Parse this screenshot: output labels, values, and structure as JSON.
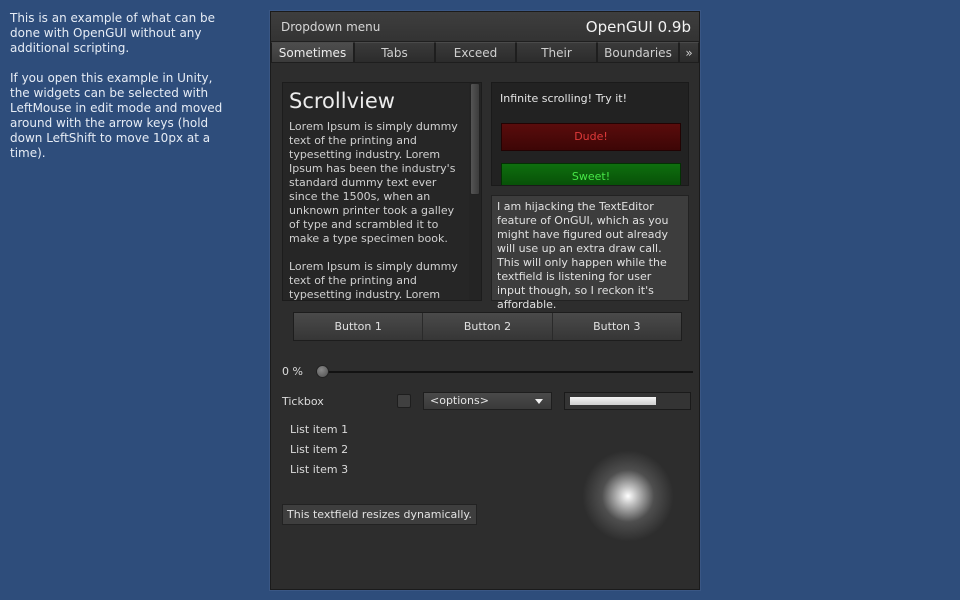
{
  "intro": {
    "paragraph1": "This is an example of what can be done with OpenGUI without any additional scripting.",
    "paragraph2": "If you open this example in Unity, the widgets can be selected with LeftMouse in edit mode and moved around with the arrow keys (hold down LeftShift to move 10px at a time)."
  },
  "window": {
    "title_left": "Dropdown menu",
    "title_right": "OpenGUI 0.9b"
  },
  "tabs": [
    "Sometimes",
    "Tabs",
    "Exceed",
    "Their",
    "Boundaries",
    "»"
  ],
  "scrollview": {
    "title": "Scrollview",
    "paragraph1": "Lorem Ipsum is simply dummy text of the printing and typesetting industry. Lorem Ipsum has been the industry's standard dummy text ever since the 1500s, when an unknown printer took a galley of type and scrambled it to make a type specimen book.",
    "paragraph2": "Lorem Ipsum is simply dummy text of the printing and typesetting industry. Lorem"
  },
  "infinite": {
    "label": "Infinite scrolling! Try it!",
    "button_red": "Dude!",
    "button_green": "Sweet!"
  },
  "texteditor": {
    "text": "I am hijacking the TextEditor feature of OnGUI, which as you might have figured out already will use up an extra draw call. This will only happen while the textfield is listening for user input though, so I reckon it's affordable."
  },
  "buttons": [
    "Button 1",
    "Button 2",
    "Button 3"
  ],
  "slider": {
    "label": "0 %",
    "value": 0
  },
  "tickbox": {
    "label": "Tickbox",
    "checked": false
  },
  "dropdown": {
    "selected": "<options>"
  },
  "progress": {
    "value": 0.75
  },
  "list": [
    "List item 1",
    "List item 2",
    "List item 3"
  ],
  "textfield": {
    "value": "This textfield resizes dynamically."
  },
  "colors": {
    "background": "#2e4d7b",
    "panel": "#2d2d2d",
    "red_button": "#5a0c0c",
    "green_button": "#0e6f0e",
    "red_text": "#e03a3a",
    "green_text": "#47e847"
  }
}
